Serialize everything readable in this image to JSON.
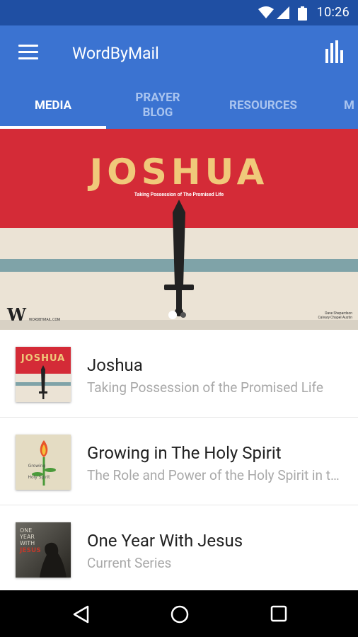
{
  "status_bar": {
    "time": "10:26"
  },
  "app_bar": {
    "title": "WordByMail"
  },
  "tabs": [
    {
      "label": "MEDIA",
      "active": true
    },
    {
      "label": "PRAYER\nBLOG",
      "active": false
    },
    {
      "label": "RESOURCES",
      "active": false
    },
    {
      "label": "M",
      "active": false
    }
  ],
  "hero": {
    "title": "JOSHUA",
    "subtitle": "Taking Possession of The Promised Life",
    "logo_letter": "W",
    "logo_url_text": "WORDBYMAIL.COM",
    "credit_line1": "Dave Shepardson",
    "credit_line2": "Calvary Chapel Austin",
    "carousel_index": 1,
    "carousel_count": 2
  },
  "media_list": [
    {
      "title": "Joshua",
      "subtitle": "Taking Possession of the Promised Life",
      "thumb": "joshua"
    },
    {
      "title": "Growing in The Holy Spirit",
      "subtitle": "The Role and Power of the Holy Spirit in the Believer",
      "thumb_text": "Growing in The Holy Spirit",
      "thumb": "spirit"
    },
    {
      "title": "One Year With Jesus",
      "subtitle": "Current Series",
      "thumb_text_1": "ONE",
      "thumb_text_2": "YEAR",
      "thumb_text_3": "WITH",
      "thumb_text_4": "JESUS",
      "thumb": "jesus"
    }
  ],
  "colors": {
    "status_bar": "#1f4fa3",
    "app_bar": "#3b73d1",
    "hero_red": "#d42b37",
    "hero_blue": "#7fa3a8"
  }
}
